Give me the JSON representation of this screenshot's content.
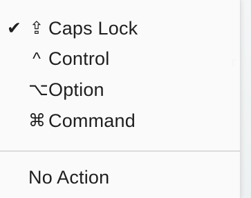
{
  "background": {
    "text_fragment": "r"
  },
  "menu": {
    "items": [
      {
        "label": "Caps Lock",
        "glyph": "⇪",
        "checked": true,
        "check_glyph": "✔"
      },
      {
        "label": "Control",
        "glyph": "^",
        "checked": false,
        "check_glyph": ""
      },
      {
        "label": "Option",
        "glyph": "⌥",
        "checked": false,
        "check_glyph": ""
      },
      {
        "label": "Command",
        "glyph": "⌘",
        "checked": false,
        "check_glyph": ""
      }
    ],
    "no_action": {
      "label": "No Action"
    }
  }
}
